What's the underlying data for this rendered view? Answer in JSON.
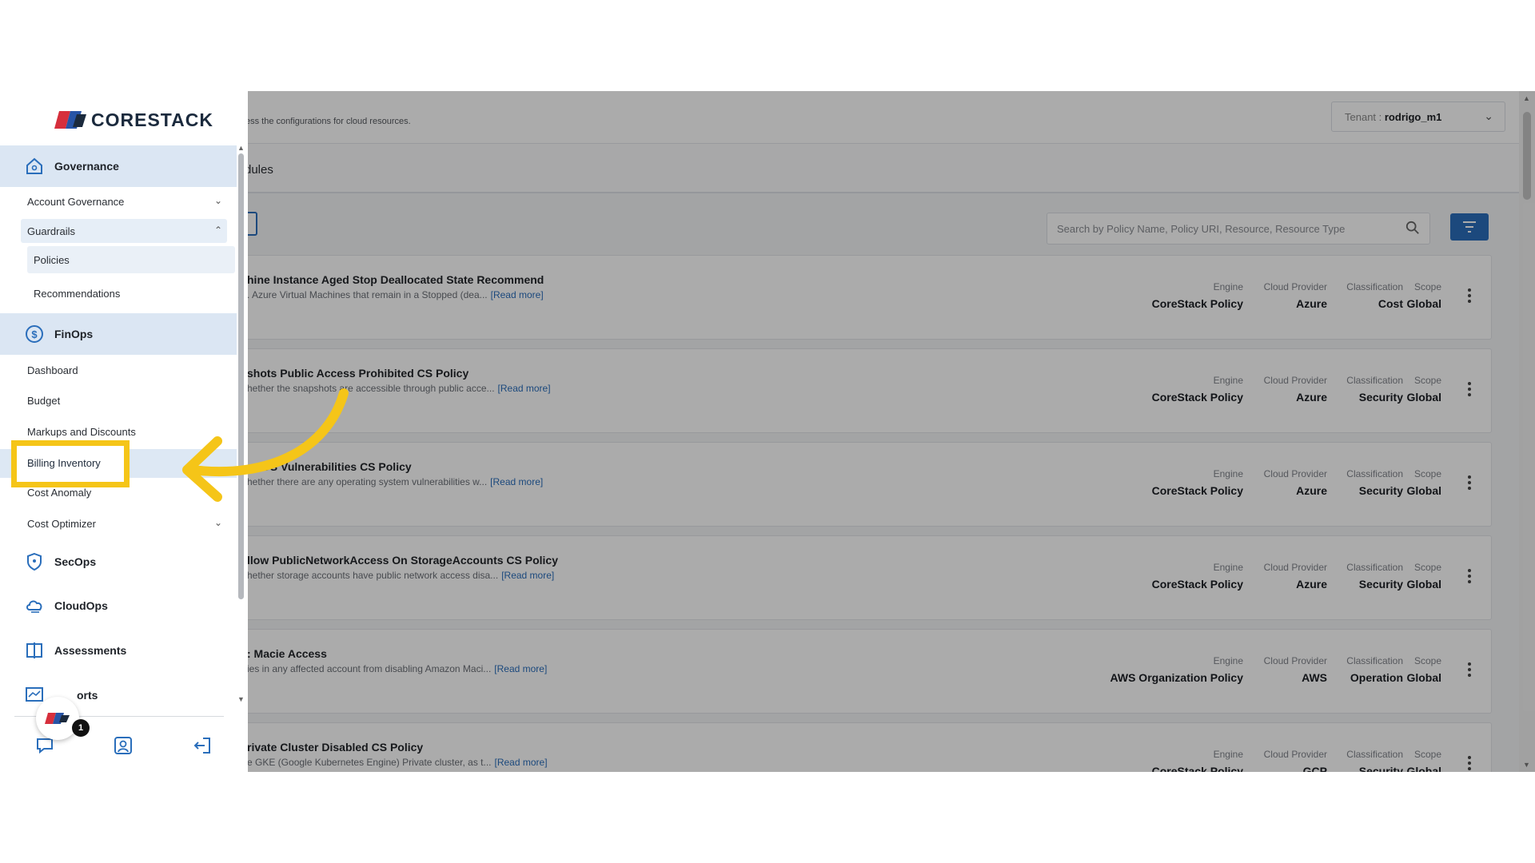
{
  "brand": {
    "name": "CORESTACK"
  },
  "header": {
    "subtitle": "ess the configurations for cloud resources.",
    "tenant_label": "Tenant : ",
    "tenant_value": "rodrigo_m1"
  },
  "tabs": {
    "active": "dules"
  },
  "search": {
    "placeholder": "Search by Policy Name, Policy URI, Resource, Resource Type"
  },
  "meta_labels": {
    "engine": "Engine",
    "cloud": "Cloud Provider",
    "classification": "Classification",
    "scope": "Scope"
  },
  "read_more": "[Read more]",
  "policies": [
    {
      "title": "hine Instance Aged Stop Deallocated State Recommend",
      "desc": ". Azure Virtual Machines that remain in a Stopped (dea...",
      "engine": "CoreStack Policy",
      "cloud": "Azure",
      "classification": "Cost",
      "scope": "Global"
    },
    {
      "title": "shots Public Access Prohibited CS Policy",
      "desc": "hether the snapshots are accessible through public acce...",
      "engine": "CoreStack Policy",
      "cloud": "Azure",
      "classification": "Security",
      "scope": "Global"
    },
    {
      "title": "or OS Vulnerabilities CS Policy",
      "desc": "hether there are any operating system vulnerabilities w...",
      "engine": "CoreStack Policy",
      "cloud": "Azure",
      "classification": "Security",
      "scope": "Global"
    },
    {
      "title": "llow PublicNetworkAccess On StorageAccounts CS Policy",
      "desc": "hether storage accounts have public network access disa...",
      "engine": "CoreStack Policy",
      "cloud": "Azure",
      "classification": "Security",
      "scope": "Global"
    },
    {
      "title": ": Macie Access",
      "desc": "ies in any affected account from disabling Amazon Maci...",
      "engine": "AWS Organization Policy",
      "cloud": "AWS",
      "classification": "Operation",
      "scope": "Global"
    },
    {
      "title": "rivate Cluster Disabled CS Policy",
      "desc": "e GKE (Google Kubernetes Engine) Private cluster, as t...",
      "engine": "CoreStack Policy",
      "cloud": "GCP",
      "classification": "Security",
      "scope": "Global"
    }
  ],
  "sidebar": {
    "governance": "Governance",
    "account_governance": "Account Governance",
    "guardrails": "Guardrails",
    "policies": "Policies",
    "recommendations": "Recommendations",
    "finops": "FinOps",
    "dashboard": "Dashboard",
    "budget": "Budget",
    "markups": "Markups and Discounts",
    "billing_inventory": "Billing Inventory",
    "cost_anomaly": "Cost Anomaly",
    "cost_optimizer": "Cost Optimizer",
    "secops": "SecOps",
    "cloudops": "CloudOps",
    "assessments": "Assessments",
    "reports": "orts",
    "notification_count": "1"
  },
  "icons": [
    "home-icon",
    "dollar-icon",
    "shield-icon",
    "cloud-icon",
    "assessment-icon",
    "report-icon",
    "chat-icon",
    "profile-icon",
    "logout-icon",
    "search-icon",
    "filter-icon",
    "kebab-icon"
  ],
  "colors": {
    "accent": "#2a6ebb",
    "highlight": "#f5c518",
    "annotation_arrow": "#f5c518"
  }
}
